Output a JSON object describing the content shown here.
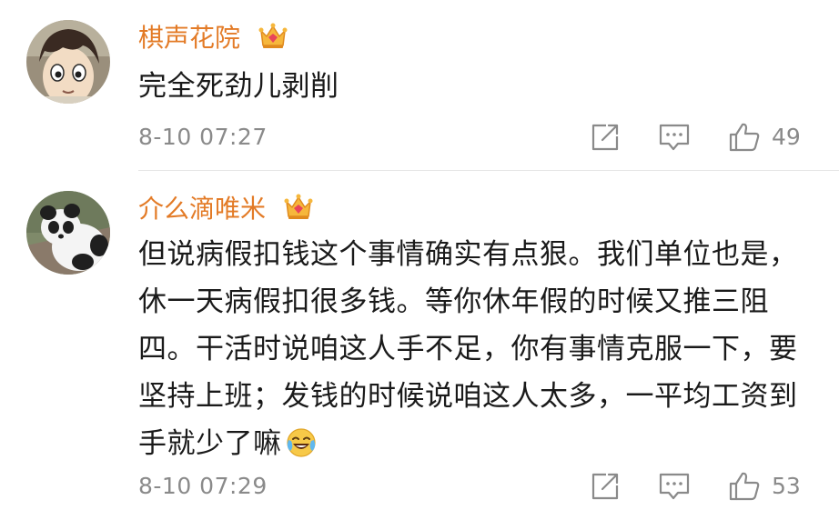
{
  "comments": [
    {
      "username": "棋声花院",
      "text": "完全死劲儿剥削",
      "timestamp": "8-10 07:27",
      "likes": "49",
      "avatar_icon": "anime-boy-avatar",
      "badge_icon": "vip-crown-icon"
    },
    {
      "username": "介么滴唯米",
      "text": "但说病假扣钱这个事情确实有点狠。我们单位也是，休一天病假扣很多钱。等你休年假的时候又推三阻四。干活时说咱这人手不足，你有事情克服一下，要坚持上班；发钱的时候说咱这人太多，一平均工资到手就少了嘛",
      "emoji_icon": "laugh-cry-emoji",
      "timestamp": "8-10 07:29",
      "likes": "53",
      "avatar_icon": "panda-avatar",
      "badge_icon": "vip-crown-icon"
    }
  ],
  "colors": {
    "username": "#e37b27",
    "text": "#1a1a1a",
    "meta": "#8a8a8a",
    "divider": "#e6e6e6"
  }
}
